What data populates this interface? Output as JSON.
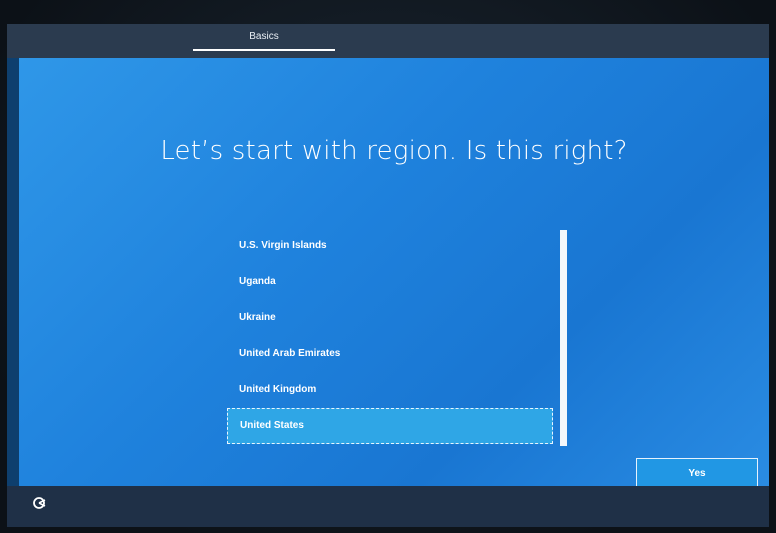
{
  "header": {
    "tab_label": "Basics"
  },
  "page": {
    "title": "Let’s start with region. Is this right?"
  },
  "regions": [
    "U.S. Virgin Islands",
    "Uganda",
    "Ukraine",
    "United Arab Emirates",
    "United Kingdom",
    "United States"
  ],
  "selected_region": "United States",
  "buttons": {
    "yes_label": "Yes"
  },
  "icons": {
    "bottom_left": "ease-of-access-icon"
  },
  "colors": {
    "screen_blue": "#1f82dd",
    "selected_item": "#2fa6e6",
    "top_bar": "#2b3b4f"
  }
}
